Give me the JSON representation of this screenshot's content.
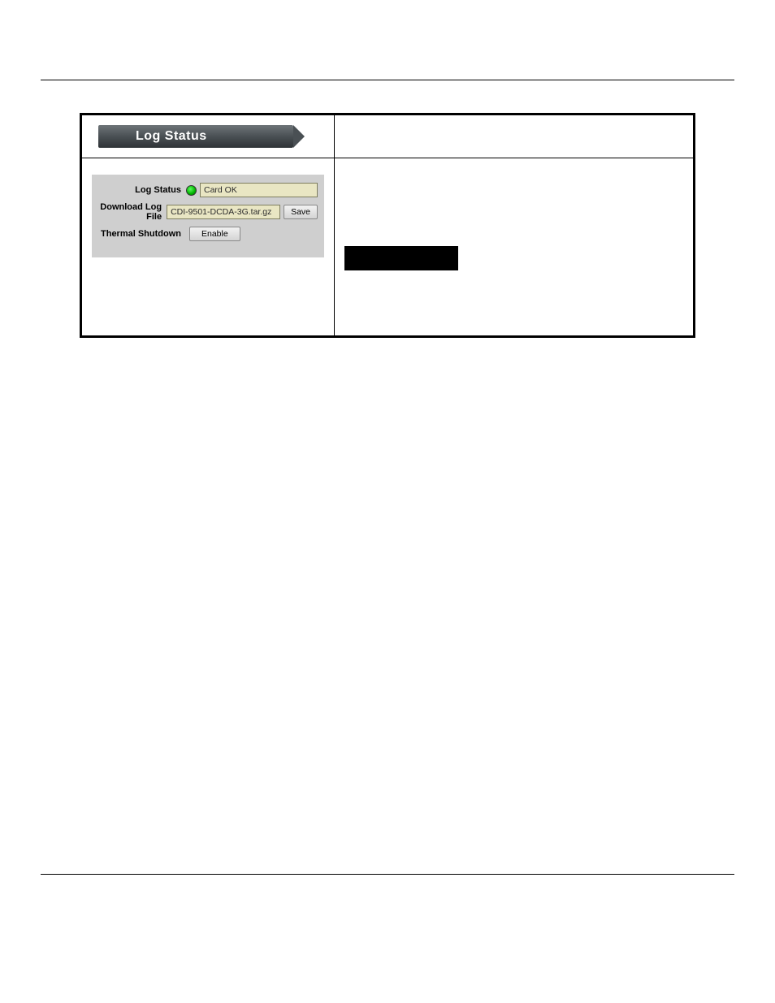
{
  "banner": {
    "title": "Log Status"
  },
  "panel": {
    "row1": {
      "label": "Log Status",
      "value": "Card OK"
    },
    "row2": {
      "label": "Download Log File",
      "value": "CDI-9501-DCDA-3G.tar.gz",
      "button": "Save"
    },
    "row3": {
      "label": "Thermal Shutdown",
      "button": "Enable"
    }
  }
}
